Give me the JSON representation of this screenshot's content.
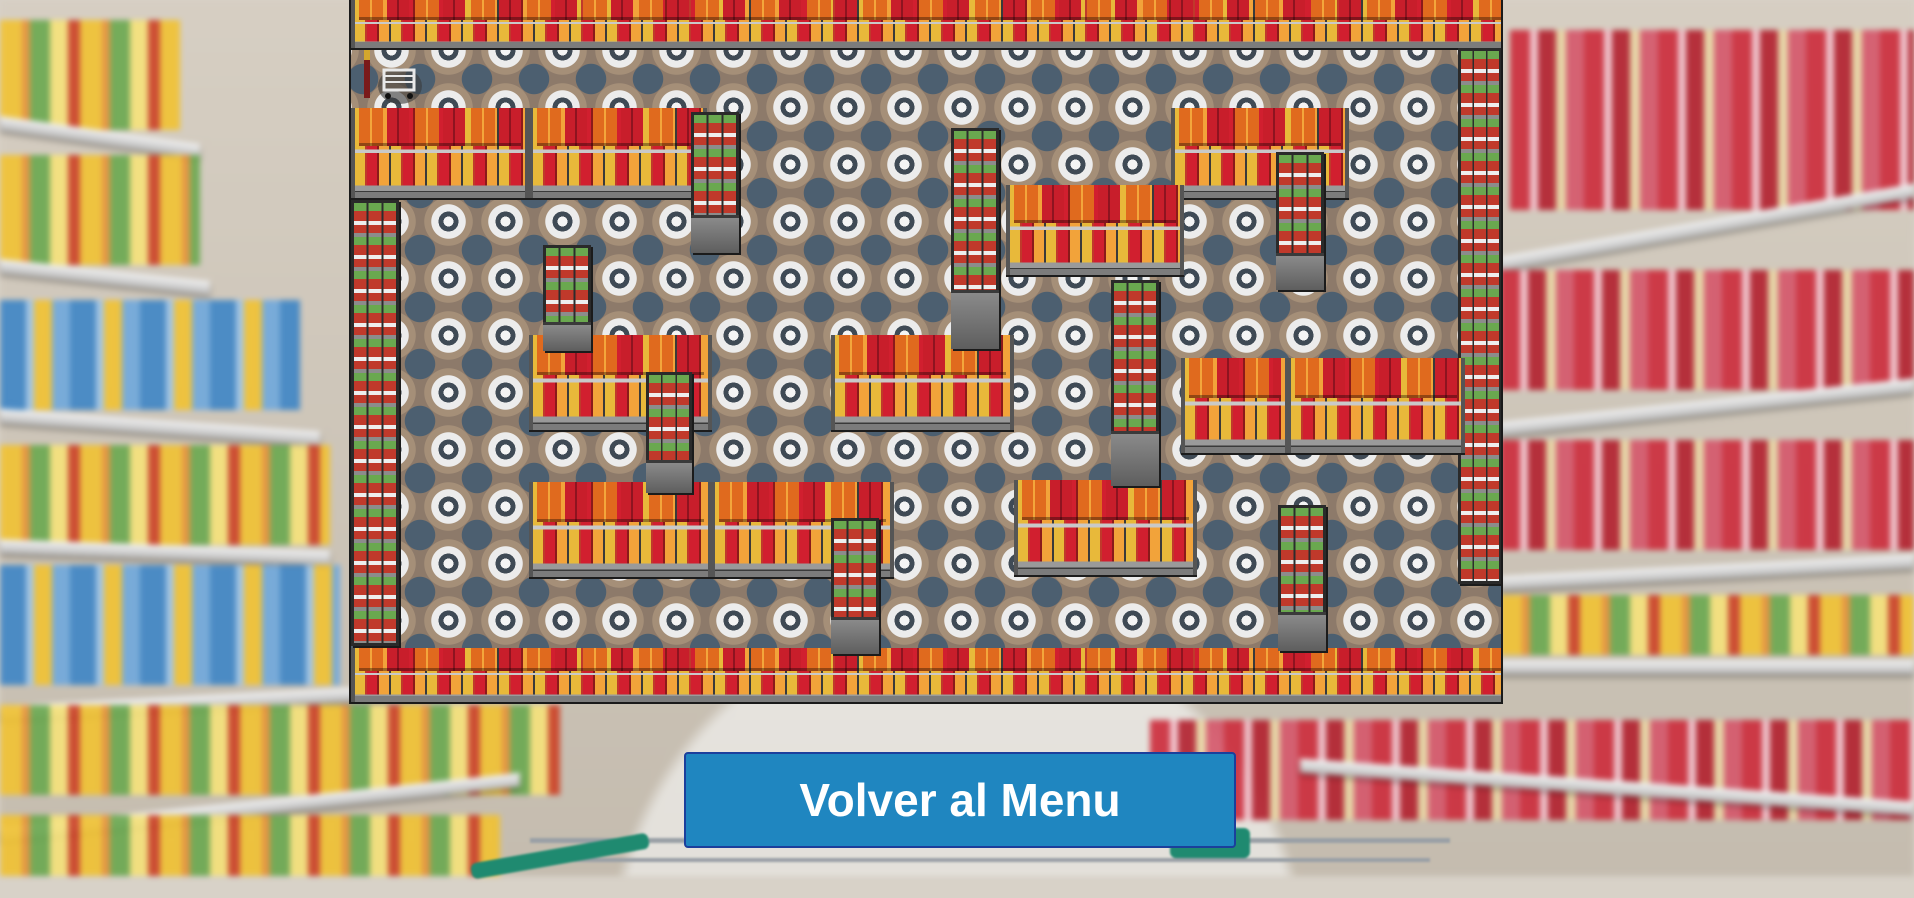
{
  "game": {
    "player": {
      "icon": "shopping-cart-icon"
    },
    "board": {
      "floor_tile": "tiled-floor-pattern",
      "obstacle": "store-shelf"
    }
  },
  "menu_button": {
    "label": "Volver al Menu"
  },
  "colors": {
    "button_bg": "#1f86c0",
    "button_border": "#1b3f9c",
    "button_text": "#ffffff"
  }
}
